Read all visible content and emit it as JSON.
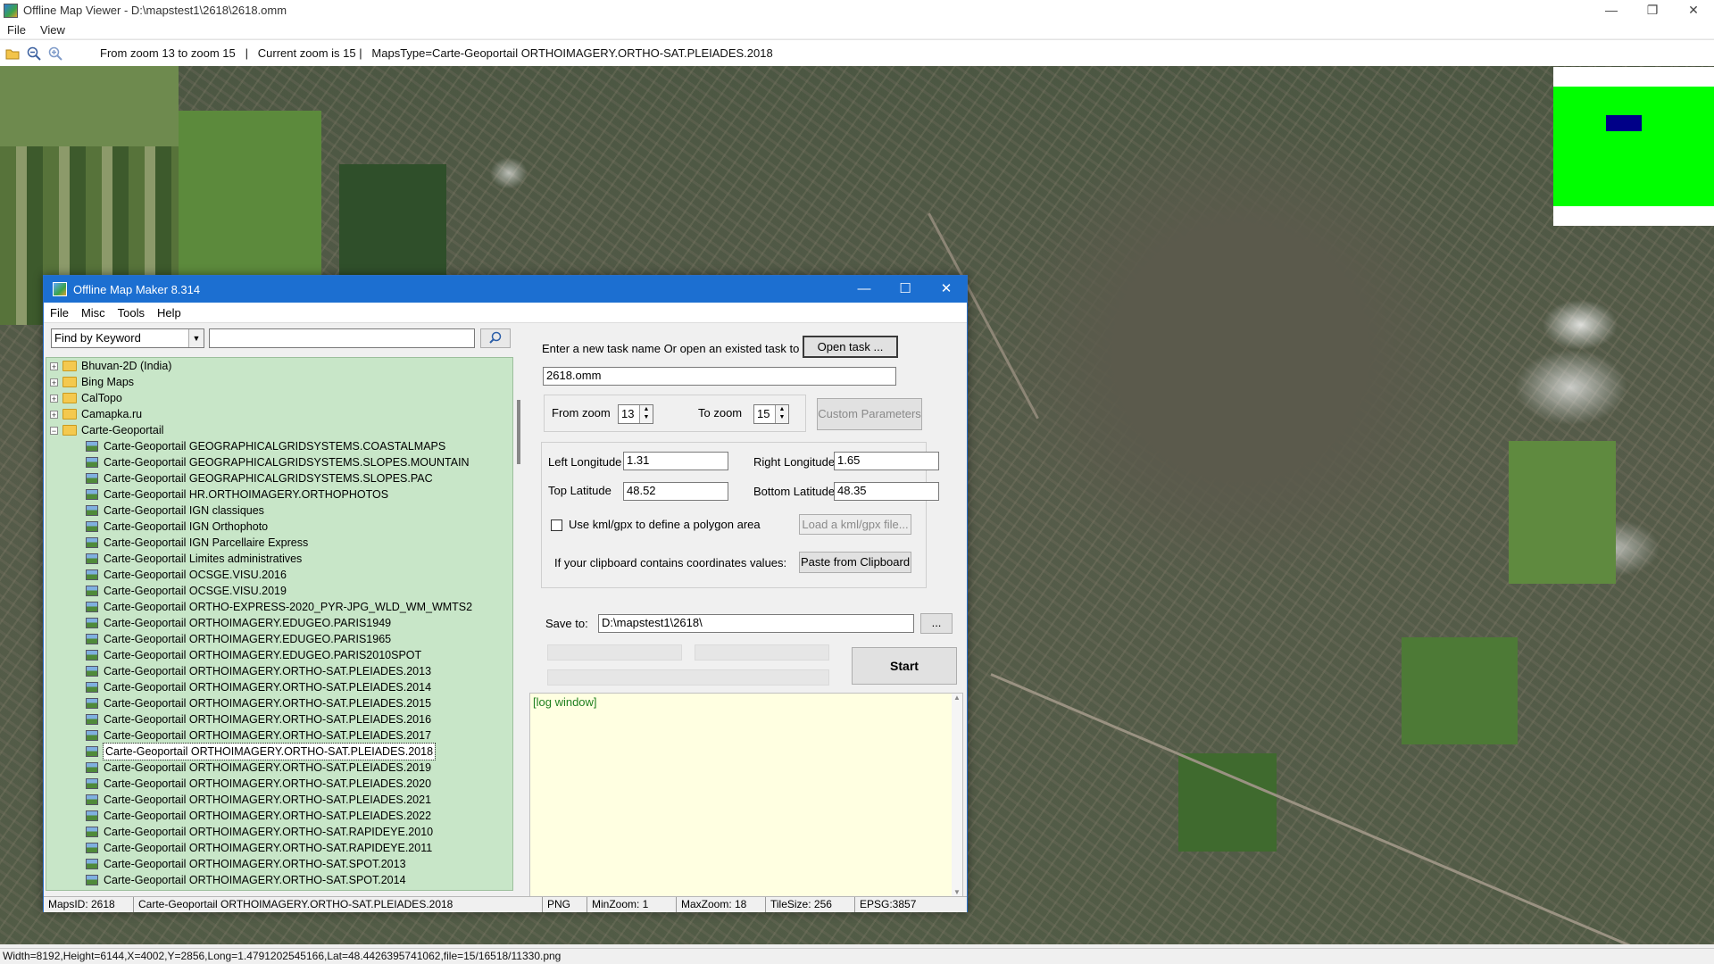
{
  "window": {
    "title": "Offline Map Viewer - D:\\mapstest1\\2618\\2618.omm",
    "controls": [
      "—",
      "❐",
      "✕"
    ]
  },
  "menu": [
    "File",
    "View"
  ],
  "toolbar": {
    "info": "From zoom 13 to zoom 15   |   Current zoom is 15 |   MapsType=Carte-Geoportail ORTHOIMAGERY.ORTHO-SAT.PLEIADES.2018"
  },
  "status_bar": "Width=8192,Height=6144,X=4002,Y=2856,Long=1.4791202545166,Lat=48.4426395741062,file=15/16518/11330.png",
  "dialog": {
    "title": "Offline Map Maker 8.314",
    "controls": [
      "—",
      "☐",
      "✕"
    ],
    "menu": [
      "File",
      "Misc",
      "Tools",
      "Help"
    ],
    "search": {
      "mode": "Find by Keyword",
      "query": ""
    },
    "tree": [
      {
        "label": "Bhuvan-2D (India)",
        "level": 0,
        "type": "folder",
        "expander": "+"
      },
      {
        "label": "Bing Maps",
        "level": 0,
        "type": "folder",
        "expander": "+"
      },
      {
        "label": "CalTopo",
        "level": 0,
        "type": "folder",
        "expander": "+"
      },
      {
        "label": "Camapka.ru",
        "level": 0,
        "type": "folder",
        "expander": "+"
      },
      {
        "label": "Carte-Geoportail",
        "level": 0,
        "type": "folder",
        "expander": "−"
      },
      {
        "label": "Carte-Geoportail GEOGRAPHICALGRIDSYSTEMS.COASTALMAPS",
        "level": 1,
        "type": "map"
      },
      {
        "label": "Carte-Geoportail GEOGRAPHICALGRIDSYSTEMS.SLOPES.MOUNTAIN",
        "level": 1,
        "type": "map"
      },
      {
        "label": "Carte-Geoportail GEOGRAPHICALGRIDSYSTEMS.SLOPES.PAC",
        "level": 1,
        "type": "map"
      },
      {
        "label": "Carte-Geoportail HR.ORTHOIMAGERY.ORTHOPHOTOS",
        "level": 1,
        "type": "map"
      },
      {
        "label": "Carte-Geoportail IGN classiques",
        "level": 1,
        "type": "map"
      },
      {
        "label": "Carte-Geoportail IGN Orthophoto",
        "level": 1,
        "type": "map"
      },
      {
        "label": "Carte-Geoportail IGN Parcellaire Express",
        "level": 1,
        "type": "map"
      },
      {
        "label": "Carte-Geoportail Limites administratives",
        "level": 1,
        "type": "map"
      },
      {
        "label": "Carte-Geoportail OCSGE.VISU.2016",
        "level": 1,
        "type": "map"
      },
      {
        "label": "Carte-Geoportail OCSGE.VISU.2019",
        "level": 1,
        "type": "map"
      },
      {
        "label": "Carte-Geoportail ORTHO-EXPRESS-2020_PYR-JPG_WLD_WM_WMTS2",
        "level": 1,
        "type": "map"
      },
      {
        "label": "Carte-Geoportail ORTHOIMAGERY.EDUGEO.PARIS1949",
        "level": 1,
        "type": "map"
      },
      {
        "label": "Carte-Geoportail ORTHOIMAGERY.EDUGEO.PARIS1965",
        "level": 1,
        "type": "map"
      },
      {
        "label": "Carte-Geoportail ORTHOIMAGERY.EDUGEO.PARIS2010SPOT",
        "level": 1,
        "type": "map"
      },
      {
        "label": "Carte-Geoportail ORTHOIMAGERY.ORTHO-SAT.PLEIADES.2013",
        "level": 1,
        "type": "map"
      },
      {
        "label": "Carte-Geoportail ORTHOIMAGERY.ORTHO-SAT.PLEIADES.2014",
        "level": 1,
        "type": "map"
      },
      {
        "label": "Carte-Geoportail ORTHOIMAGERY.ORTHO-SAT.PLEIADES.2015",
        "level": 1,
        "type": "map"
      },
      {
        "label": "Carte-Geoportail ORTHOIMAGERY.ORTHO-SAT.PLEIADES.2016",
        "level": 1,
        "type": "map"
      },
      {
        "label": "Carte-Geoportail ORTHOIMAGERY.ORTHO-SAT.PLEIADES.2017",
        "level": 1,
        "type": "map"
      },
      {
        "label": "Carte-Geoportail ORTHOIMAGERY.ORTHO-SAT.PLEIADES.2018",
        "level": 1,
        "type": "map",
        "selected": true
      },
      {
        "label": "Carte-Geoportail ORTHOIMAGERY.ORTHO-SAT.PLEIADES.2019",
        "level": 1,
        "type": "map"
      },
      {
        "label": "Carte-Geoportail ORTHOIMAGERY.ORTHO-SAT.PLEIADES.2020",
        "level": 1,
        "type": "map"
      },
      {
        "label": "Carte-Geoportail ORTHOIMAGERY.ORTHO-SAT.PLEIADES.2021",
        "level": 1,
        "type": "map"
      },
      {
        "label": "Carte-Geoportail ORTHOIMAGERY.ORTHO-SAT.PLEIADES.2022",
        "level": 1,
        "type": "map"
      },
      {
        "label": "Carte-Geoportail ORTHOIMAGERY.ORTHO-SAT.RAPIDEYE.2010",
        "level": 1,
        "type": "map"
      },
      {
        "label": "Carte-Geoportail ORTHOIMAGERY.ORTHO-SAT.RAPIDEYE.2011",
        "level": 1,
        "type": "map"
      },
      {
        "label": "Carte-Geoportail ORTHOIMAGERY.ORTHO-SAT.SPOT.2013",
        "level": 1,
        "type": "map"
      },
      {
        "label": "Carte-Geoportail ORTHOIMAGERY.ORTHO-SAT.SPOT.2014",
        "level": 1,
        "type": "map"
      }
    ],
    "task": {
      "prompt": "Enter a new task name Or open an existed task to continue:",
      "open_button": "Open task ...",
      "name": "2618.omm"
    },
    "zoom": {
      "from_label": "From zoom",
      "from_value": "13",
      "to_label": "To zoom",
      "to_value": "15",
      "custom_button": "Custom Parameters"
    },
    "coords": {
      "left_label": "Left Longitude",
      "left_value": "1.31",
      "right_label": "Right Longitude",
      "right_value": "1.65",
      "top_label": "Top Latitude",
      "top_value": "48.52",
      "bottom_label": "Bottom Latitude",
      "bottom_value": "48.35",
      "kml_label": "Use kml/gpx to define a polygon area",
      "kml_button": "Load a kml/gpx file...",
      "clipboard_label": "If your clipboard contains coordinates values:",
      "clipboard_button": "Paste from Clipboard"
    },
    "save": {
      "label": "Save to:",
      "path": "D:\\mapstest1\\2618\\",
      "browse_button": "...",
      "start_button": "Start"
    },
    "log": "[log window]",
    "status": {
      "maps_id": "MapsID: 2618",
      "map_name": "Carte-Geoportail ORTHOIMAGERY.ORTHO-SAT.PLEIADES.2018",
      "format": "PNG",
      "min_zoom": "MinZoom: 1",
      "max_zoom": "MaxZoom: 18",
      "tile_size": "TileSize: 256",
      "epsg": "EPSG:3857"
    }
  },
  "overview": {
    "frame_color": "#00ff00",
    "viewport_color": "#000088"
  }
}
